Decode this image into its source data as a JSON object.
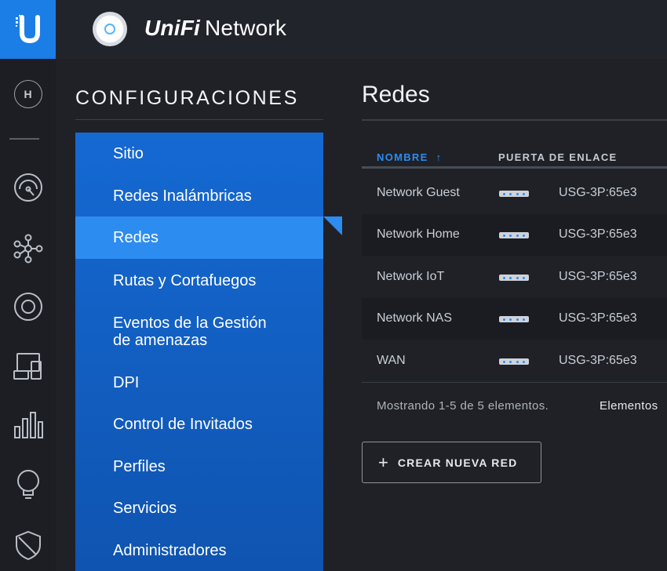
{
  "header": {
    "logo_icon": "ubiquiti-u-logo-icon",
    "device_icon": "access-point-icon",
    "app_name_prefix": "UniFi",
    "app_name_suffix": "Network"
  },
  "rail": {
    "site_initial": "H",
    "items": [
      {
        "icon": "dashboard-gauge-icon"
      },
      {
        "icon": "topology-map-icon"
      },
      {
        "icon": "devices-icon"
      },
      {
        "icon": "clients-icon"
      },
      {
        "icon": "statistics-icon"
      },
      {
        "icon": "insights-bulb-icon"
      },
      {
        "icon": "threat-shield-icon"
      }
    ]
  },
  "settings": {
    "title": "CONFIGURACIONES",
    "items": [
      {
        "label": "Sitio"
      },
      {
        "label": "Redes Inalámbricas"
      },
      {
        "label": "Redes"
      },
      {
        "label": "Rutas y Cortafuegos"
      },
      {
        "label": "Eventos de la Gestión\nde amenazas"
      },
      {
        "label": "DPI"
      },
      {
        "label": "Control de Invitados"
      },
      {
        "label": "Perfiles"
      },
      {
        "label": "Servicios"
      },
      {
        "label": "Administradores"
      }
    ],
    "active_label": "Redes"
  },
  "main": {
    "title": "Redes",
    "columns": {
      "name": "NOMBRE",
      "sort_arrow": "↑",
      "gateway": "PUERTA DE ENLACE"
    },
    "rows": [
      {
        "name": "Network Guest",
        "gateway": "USG-3P:65e3"
      },
      {
        "name": "Network Home",
        "gateway": "USG-3P:65e3"
      },
      {
        "name": "Network IoT",
        "gateway": "USG-3P:65e3"
      },
      {
        "name": "Network NAS",
        "gateway": "USG-3P:65e3"
      },
      {
        "name": "WAN",
        "gateway": "USG-3P:65e3"
      }
    ],
    "showing_text": "Mostrando 1-5 de 5 elementos.",
    "per_page_text": "Elementos",
    "create_button": {
      "icon": "plus-icon",
      "label": "CREAR NUEVA RED"
    }
  },
  "colors": {
    "accent": "#1a7ee6",
    "menu_bg": "#1569d3",
    "menu_active": "#2d8cf0",
    "background": "#1f2127"
  }
}
